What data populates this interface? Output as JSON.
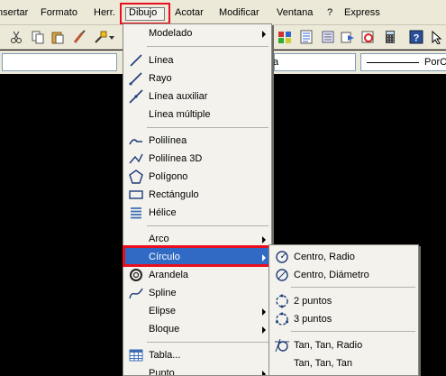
{
  "menubar": {
    "items": [
      {
        "label": "Insertar"
      },
      {
        "label": "Formato"
      },
      {
        "label": "Herr."
      },
      {
        "label": "Dibujo"
      },
      {
        "label": "Acotar"
      },
      {
        "label": "Modificar"
      },
      {
        "label": "Ventana"
      },
      {
        "label": "?"
      },
      {
        "label": "Express"
      }
    ]
  },
  "toolbar2": {
    "layer_fragment": "a",
    "linetype_value": "PorC"
  },
  "dibujo_menu": {
    "items": [
      {
        "label": "Modelado",
        "submenu": true,
        "icon": "none"
      },
      {
        "label": "Línea",
        "icon": "line-icon"
      },
      {
        "label": "Rayo",
        "icon": "ray-icon"
      },
      {
        "label": "Línea auxiliar",
        "icon": "xline-icon"
      },
      {
        "label": "Línea múltiple",
        "icon": "none"
      },
      {
        "label": "Polilínea",
        "icon": "polyline-icon"
      },
      {
        "label": "Polilínea 3D",
        "icon": "polyline-3d-icon"
      },
      {
        "label": "Polígono",
        "icon": "polygon-icon"
      },
      {
        "label": "Rectángulo",
        "icon": "rectangle-icon"
      },
      {
        "label": "Hélice",
        "icon": "helix-icon"
      },
      {
        "label": "Arco",
        "submenu": true,
        "icon": "none"
      },
      {
        "label": "Círculo",
        "submenu": true,
        "active": true,
        "icon": "none"
      },
      {
        "label": "Arandela",
        "icon": "donut-icon"
      },
      {
        "label": "Spline",
        "icon": "spline-icon"
      },
      {
        "label": "Elipse",
        "submenu": true,
        "icon": "none"
      },
      {
        "label": "Bloque",
        "submenu": true,
        "icon": "none"
      },
      {
        "label": "Tabla...",
        "icon": "table-icon"
      },
      {
        "label": "Punto",
        "submenu": true,
        "icon": "none"
      }
    ]
  },
  "circulo_submenu": {
    "items": [
      {
        "label": "Centro, Radio",
        "icon": "circle-center-radius-icon"
      },
      {
        "label": "Centro, Diámetro",
        "icon": "circle-center-diameter-icon"
      },
      {
        "label": "2 puntos",
        "icon": "circle-2points-icon"
      },
      {
        "label": "3 puntos",
        "icon": "circle-3points-icon"
      },
      {
        "label": "Tan, Tan, Radio",
        "icon": "circle-ttr-icon"
      },
      {
        "label": "Tan, Tan, Tan",
        "icon": "circle-ttt-icon"
      }
    ]
  },
  "colors": {
    "highlight_red": "#e8101f",
    "menu_selection": "#316ac5",
    "menu_background": "#f3f2ec",
    "chrome": "#ece9d8"
  }
}
